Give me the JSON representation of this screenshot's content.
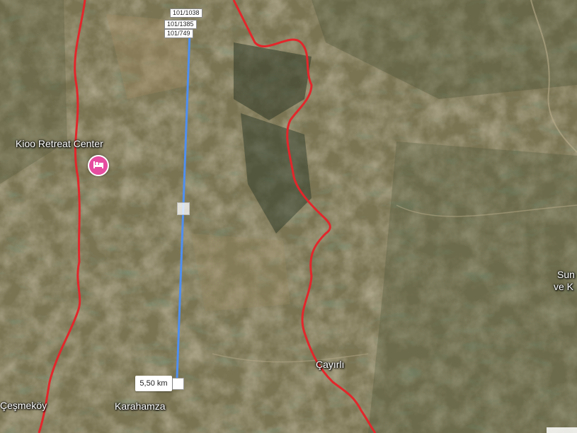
{
  "map": {
    "places": {
      "retreat": "Kioo Retreat Center",
      "cesmekoy": "Çeşmeköy",
      "karahamza": "Karahamza",
      "cayirli": "Çayırlı",
      "sun_partial": "Sun",
      "ve_partial": "ve K"
    },
    "measure": {
      "distance": "5,50 km",
      "tags": [
        "101/1038",
        "101/1385",
        "101/749"
      ]
    },
    "colors": {
      "boundary": "#e3262b",
      "measure_line": "#4f8ff0",
      "hotel_pin": "#e64ca0"
    }
  }
}
